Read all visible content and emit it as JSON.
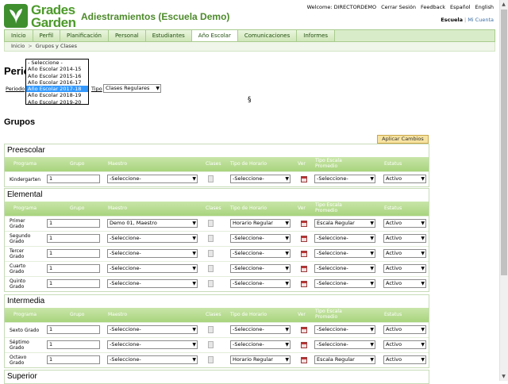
{
  "header": {
    "logo_line1": "Grades",
    "logo_line2": "Garden",
    "app_title": "Adiestramientos (Escuela Demo)",
    "welcome": "Welcome: DIRECTORDEMO",
    "logout": "Cerrar Sesión",
    "feedback": "Feedback",
    "lang_es": "Español",
    "lang_en": "English",
    "school_label": "Escuela",
    "my_account": "Mi Cuenta"
  },
  "nav": {
    "tabs": [
      {
        "label": "Inicio"
      },
      {
        "label": "Perfil"
      },
      {
        "label": "Planificación"
      },
      {
        "label": "Personal"
      },
      {
        "label": "Estudiantes"
      },
      {
        "label": "Año Escolar"
      },
      {
        "label": "Comunicaciones"
      },
      {
        "label": "Informes"
      }
    ],
    "active": "Año Escolar"
  },
  "breadcrumb": {
    "home": "Inicio",
    "arrow": ">",
    "current": "Grupos y Clases"
  },
  "period": {
    "heading_partial": "Perio",
    "periodo_label": "Periodo",
    "tipo_label": "Tipo",
    "tipo_value": "Clases Regulares",
    "dropdown_options": [
      "- Seleccione -",
      "Año Escolar 2014-15",
      "Año Escolar 2015-16",
      "Año Escolar 2016-17",
      "Año Escolar 2017-18",
      "Año Escolar 2018-19",
      "Año Escolar 2019-20"
    ],
    "dropdown_selected": "Año Escolar 2017-18",
    "section_mark": "§"
  },
  "grupos": {
    "title": "Grupos",
    "apply_button": "Aplicar Cambios",
    "columns": {
      "programa": "Programa",
      "grupo": "Grupo",
      "maestro": "Maestro",
      "clases": "Clases",
      "tipo_horario": "Tipo de Horario",
      "ver": "Ver",
      "tipo_escala_1": "Tipo Escala",
      "tipo_escala_2": "Promedio",
      "estatus": "Estatus"
    },
    "sections": [
      {
        "title": "Preescolar",
        "rows": [
          {
            "name1": "Kindergarten",
            "name2": "",
            "grupo": "1",
            "maestro": "-Seleccione-",
            "horario": "-Seleccione-",
            "escala": "-Seleccione-",
            "estatus": "Activo"
          }
        ]
      },
      {
        "title": "Elemental",
        "rows": [
          {
            "name1": "Primer",
            "name2": "Grado",
            "grupo": "1",
            "maestro": "Demo 01, Maestro",
            "horario": "Horario Regular",
            "escala": "Escala Regular",
            "estatus": "Activo"
          },
          {
            "name1": "Segundo",
            "name2": "Grado",
            "grupo": "1",
            "maestro": "-Seleccione-",
            "horario": "-Seleccione-",
            "escala": "-Seleccione-",
            "estatus": "Activo"
          },
          {
            "name1": "Tercer",
            "name2": "Grado",
            "grupo": "1",
            "maestro": "-Seleccione-",
            "horario": "-Seleccione-",
            "escala": "-Seleccione-",
            "estatus": "Activo"
          },
          {
            "name1": "Cuarto",
            "name2": "Grado",
            "grupo": "1",
            "maestro": "-Seleccione-",
            "horario": "-Seleccione-",
            "escala": "-Seleccione-",
            "estatus": "Activo"
          },
          {
            "name1": "Quinto",
            "name2": "Grado",
            "grupo": "1",
            "maestro": "-Seleccione-",
            "horario": "-Seleccione-",
            "escala": "-Seleccione-",
            "estatus": "Activo"
          }
        ]
      },
      {
        "title": "Intermedia",
        "rows": [
          {
            "name1": "Sexto Grado",
            "name2": "",
            "grupo": "1",
            "maestro": "-Seleccione-",
            "horario": "-Seleccione-",
            "escala": "-Seleccione-",
            "estatus": "Activo"
          },
          {
            "name1": "Séptimo",
            "name2": "Grado",
            "grupo": "1",
            "maestro": "-Seleccione-",
            "horario": "-Seleccione-",
            "escala": "-Seleccione-",
            "estatus": "Activo"
          },
          {
            "name1": "Octavo",
            "name2": "Grado",
            "grupo": "1",
            "maestro": "-Seleccione-",
            "horario": "Horario Regular",
            "escala": "Escala Regular",
            "estatus": "Activo"
          }
        ]
      },
      {
        "title": "Superior",
        "rows": []
      }
    ]
  }
}
